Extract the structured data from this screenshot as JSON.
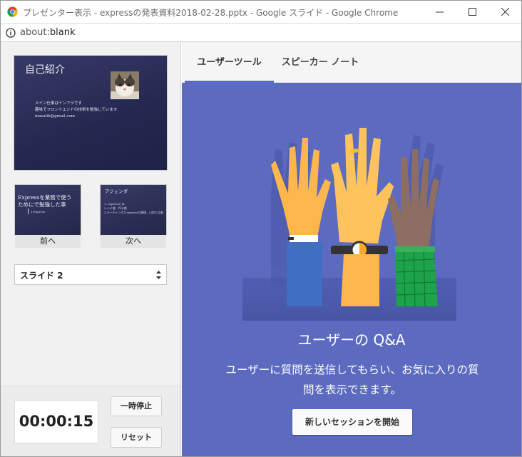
{
  "window": {
    "title": "プレゼンター表示 - expressの発表資料2018-02-28.pptx - Google スライド - Google Chrome",
    "controls": {
      "minimize": "—",
      "maximize": "☐",
      "close": "✕"
    }
  },
  "address": {
    "scheme": "about:",
    "rest": "blank"
  },
  "current_slide": {
    "title": "自己紹介",
    "body": [
      "メイン仕事はインフラです",
      "趣味でフロントエンドの技術を勉強しています",
      "masalib@gmail.com"
    ]
  },
  "prev_thumb": {
    "label": "前へ",
    "title_lines": [
      "Expressを業務で使う",
      "ためにで勉強した事"
    ],
    "subtitle": "1-Express"
  },
  "next_thumb": {
    "label": "次へ",
    "title": "アジェンダ",
    "items": [
      "1. expressとは",
      "2.ハイ感、作る感",
      "3.ルーティングとexpressの事情、以前と比較"
    ]
  },
  "slide_select": {
    "value": "スライド 2"
  },
  "timer": {
    "value": "00:00:15"
  },
  "buttons": {
    "pause": "一時停止",
    "reset": "リセット"
  },
  "tabs": {
    "users": "ユーザーツール",
    "speaker": "スピーカー ノート",
    "active": "users"
  },
  "qa": {
    "title": "ユーザーの Q&A",
    "desc_lines": [
      "ユーザーに質問を送信してもらい、お気に入りの質",
      "問を表示できます。"
    ],
    "start_button": "新しいセッションを開始"
  },
  "colors": {
    "accent": "#5c6bc0",
    "slide_bg": "#262a50"
  }
}
